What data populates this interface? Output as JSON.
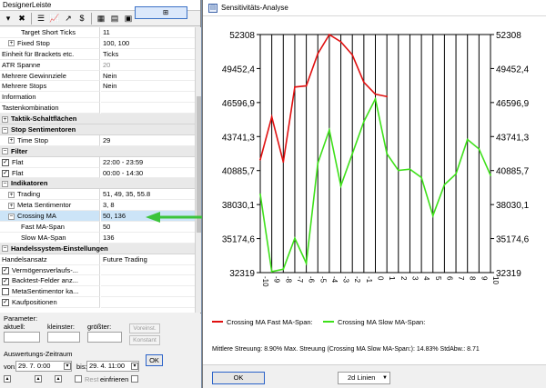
{
  "designer": {
    "title": "DesignerLeiste",
    "toolbar": [
      {
        "icon": "properties-icon",
        "glyph": "⊞"
      },
      {
        "icon": "dropdown-arrow-icon",
        "glyph": "▾"
      },
      {
        "icon": "delete-icon",
        "glyph": "✖"
      },
      {
        "icon": "list-icon",
        "glyph": "☰"
      },
      {
        "icon": "chart-icon",
        "glyph": "📈"
      },
      {
        "icon": "trend-icon",
        "glyph": "↗"
      },
      {
        "icon": "dollar-icon",
        "glyph": "$"
      },
      {
        "icon": "grid-view-icon",
        "glyph": "▦"
      },
      {
        "icon": "table-view-icon",
        "glyph": "▤"
      },
      {
        "icon": "panel-icon",
        "glyph": "▣"
      }
    ],
    "rows": [
      {
        "kind": "prop",
        "indent": 3,
        "label": "Target Short Ticks",
        "value": "11"
      },
      {
        "kind": "prop",
        "indent": 1,
        "expand": "+",
        "label": "Fixed Stop",
        "value": "100, 100"
      },
      {
        "kind": "prop",
        "indent": 0,
        "label": "Einheit für Brackets etc.",
        "value": "Ticks"
      },
      {
        "kind": "prop",
        "indent": 0,
        "label": "ATR Spanne",
        "value": "20",
        "dim": true
      },
      {
        "kind": "prop",
        "indent": 0,
        "label": "Mehrere Gewinnziele",
        "value": "Nein"
      },
      {
        "kind": "prop",
        "indent": 0,
        "label": "Mehrere Stops",
        "value": "Nein"
      },
      {
        "kind": "prop",
        "indent": 0,
        "label": "Information",
        "value": ""
      },
      {
        "kind": "prop",
        "indent": 0,
        "label": "Tastenkombination",
        "value": ""
      },
      {
        "kind": "cat",
        "expand": "+",
        "label": "Taktik-Schaltflächen"
      },
      {
        "kind": "cat",
        "expand": "−",
        "label": "Stop Sentimentoren"
      },
      {
        "kind": "prop",
        "indent": 1,
        "expand": "+",
        "label": "Time Stop",
        "value": "29"
      },
      {
        "kind": "cat",
        "expand": "−",
        "label": "Filter"
      },
      {
        "kind": "prop",
        "indent": 0,
        "check": true,
        "label": "Flat",
        "value": "22:00 - 23:59"
      },
      {
        "kind": "prop",
        "indent": 0,
        "check": true,
        "label": "Flat",
        "value": "00:00 - 14:30"
      },
      {
        "kind": "cat",
        "expand": "−",
        "label": "Indikatoren"
      },
      {
        "kind": "prop",
        "indent": 1,
        "expand": "+",
        "label": "Trading",
        "value": "51, 49, 35, 55.8"
      },
      {
        "kind": "prop",
        "indent": 1,
        "expand": "+",
        "label": "Meta Sentimentor",
        "value": "3, 8"
      },
      {
        "kind": "prop",
        "indent": 1,
        "expand": "−",
        "label": "Crossing MA",
        "value": "50, 136",
        "highlight": true
      },
      {
        "kind": "prop",
        "indent": 3,
        "label": "Fast MA-Span",
        "value": "50"
      },
      {
        "kind": "prop",
        "indent": 3,
        "label": "Slow MA-Span",
        "value": "136"
      },
      {
        "kind": "cat",
        "expand": "−",
        "label": "Handelssystem-Einstellungen"
      },
      {
        "kind": "prop",
        "indent": 0,
        "label": "Handelsansatz",
        "value": "Future Trading"
      },
      {
        "kind": "prop",
        "indent": 0,
        "check": true,
        "label": "Vermögensverlaufs-...",
        "value": ""
      },
      {
        "kind": "prop",
        "indent": 0,
        "check": true,
        "label": "Backtest-Felder anz...",
        "value": ""
      },
      {
        "kind": "prop",
        "indent": 0,
        "check": false,
        "label": "MetaSentimentor ka...",
        "value": ""
      },
      {
        "kind": "prop",
        "indent": 0,
        "check": true,
        "label": "Kaufpositionen",
        "value": ""
      }
    ],
    "params": {
      "heading": "Parameter:",
      "current_label": "aktuell:",
      "smaller_label": "kleinster:",
      "larger_label": "größter:",
      "preset_button": "Voreinst.",
      "constant_button": "Konstant",
      "period_heading": "Auswertungs-Zeitraum",
      "from_label": "von:",
      "from_value": "29. 7.  0:00",
      "to_label": "bis:",
      "to_value": "29. 4. 11:00",
      "ok_label": "OK",
      "rest_label": "Rest",
      "include_label": "einfrieren"
    }
  },
  "analysis": {
    "title": "Sensitivitäts-Analyse",
    "legend_fast": "Crossing MA Fast MA-Span:",
    "legend_slow": "Crossing MA Slow MA-Span:",
    "stats": "Mittlere Streuung: 8.90%  Max. Streuung (Crossing MA Slow MA-Span:): 14.83%  StdAbw.: 8.71",
    "ok_label": "OK",
    "view_select": "2d Linien",
    "colors": {
      "fast": "#e01010",
      "slow": "#3ee01a",
      "grid": "#000000"
    }
  },
  "chart_data": {
    "type": "line",
    "x": [
      "-10",
      "-9",
      "-8",
      "-7",
      "-6",
      "-5",
      "-4",
      "-3",
      "-2",
      "-1",
      "0",
      "1",
      "2",
      "3",
      "4",
      "5",
      "6",
      "7",
      "8",
      "9",
      "10"
    ],
    "ylim": [
      32319,
      52308
    ],
    "yticks": [
      "52308",
      "49452,4",
      "46596,9",
      "43741,3",
      "40885,7",
      "38030,1",
      "35174,6",
      "32319"
    ],
    "series": [
      {
        "name": "Crossing MA Fast MA-Span:",
        "color": "#e01010",
        "values": [
          41800,
          45400,
          41600,
          47900,
          48000,
          50700,
          52300,
          51700,
          50600,
          48300,
          47300,
          47100
        ]
      },
      {
        "name": "Crossing MA Slow MA-Span:",
        "color": "#3ee01a",
        "values": [
          38900,
          32400,
          32600,
          35200,
          33100,
          41500,
          44300,
          39600,
          42300,
          45000,
          46900,
          42300,
          40900,
          41000,
          40300,
          37100,
          39700,
          40600,
          43500,
          42700,
          40500
        ]
      }
    ]
  }
}
